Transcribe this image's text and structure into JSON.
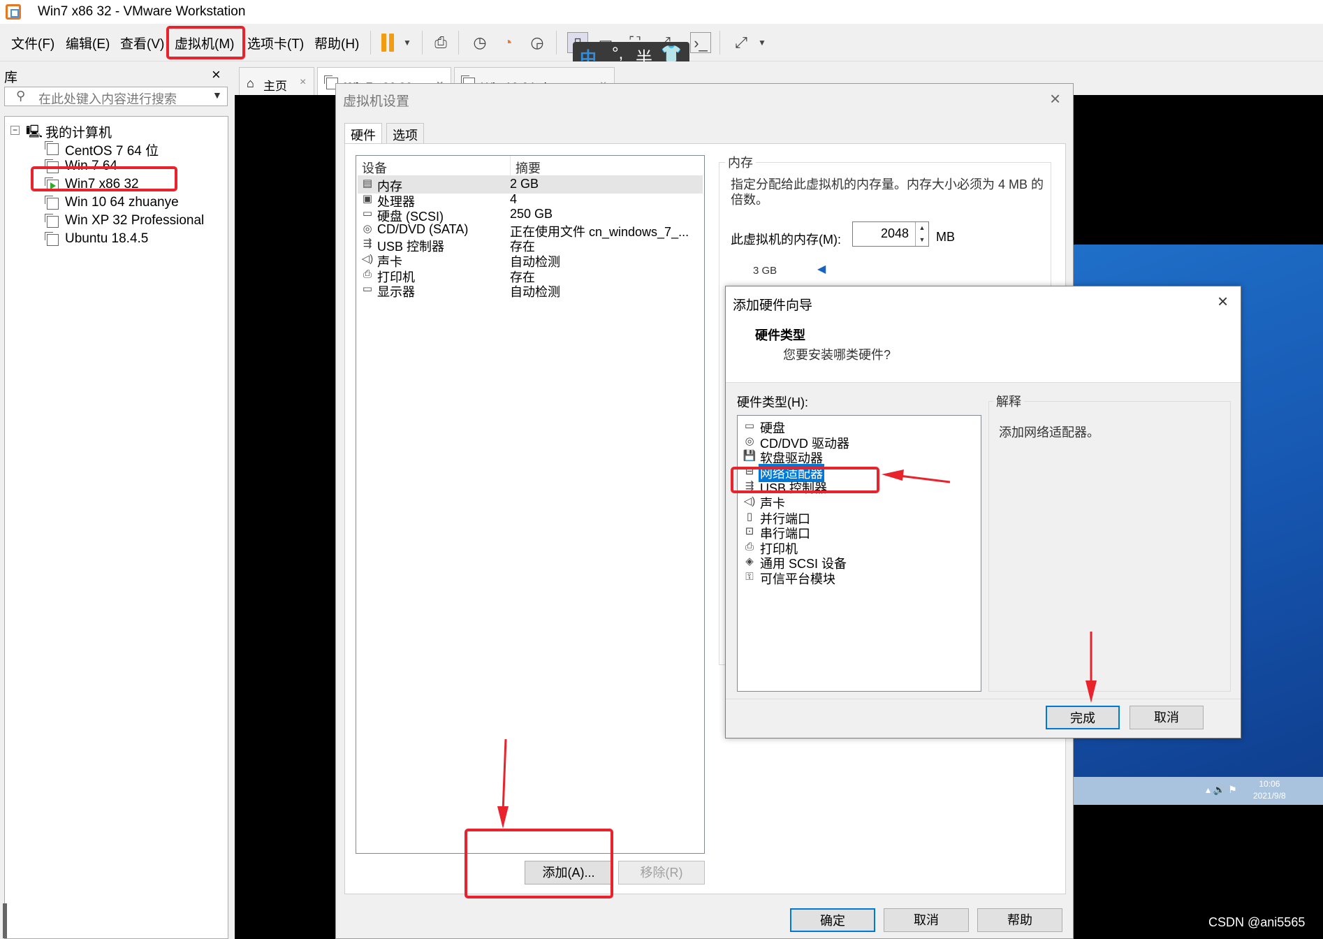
{
  "window": {
    "title": "Win7  x86  32 - VMware Workstation"
  },
  "menu": {
    "file": "文件(F)",
    "edit": "编辑(E)",
    "view": "查看(V)",
    "vm": "虚拟机(M)",
    "tabs": "选项卡(T)",
    "help": "帮助(H)"
  },
  "ime": {
    "mode": "中",
    "punct": "°,",
    "width": "半",
    "skin": "👕"
  },
  "library": {
    "title": "库",
    "search_placeholder": "在此处键入内容进行搜索",
    "root": "我的计算机",
    "vms": [
      "CentOS 7 64 位",
      "Win 7 64",
      "Win7  x86  32",
      "Win 10 64 zhuanye",
      "Win XP  32 Professional",
      "Ubuntu 18.4.5"
    ]
  },
  "doc_tabs": [
    {
      "label": "主页"
    },
    {
      "label": "Win7  x86  32"
    },
    {
      "label": "Win 10 64 zhuanye"
    }
  ],
  "settings": {
    "title": "虚拟机设置",
    "tabs": [
      "硬件",
      "选项"
    ],
    "col_device": "设备",
    "col_summary": "摘要",
    "devices": [
      {
        "icon": "memory-icon",
        "name": "内存",
        "summary": "2 GB"
      },
      {
        "icon": "processor-icon",
        "name": "处理器",
        "summary": "4"
      },
      {
        "icon": "harddisk-icon",
        "name": "硬盘 (SCSI)",
        "summary": "250 GB"
      },
      {
        "icon": "cd-icon",
        "name": "CD/DVD (SATA)",
        "summary": "正在使用文件 cn_windows_7_..."
      },
      {
        "icon": "usb-icon",
        "name": "USB 控制器",
        "summary": "存在"
      },
      {
        "icon": "sound-icon",
        "name": "声卡",
        "summary": "自动检测"
      },
      {
        "icon": "printer-icon",
        "name": "打印机",
        "summary": "存在"
      },
      {
        "icon": "display-icon",
        "name": "显示器",
        "summary": "自动检测"
      }
    ],
    "memory": {
      "group": "内存",
      "desc": "指定分配给此虚拟机的内存量。内存大小必须为 4 MB 的倍数。",
      "label": "此虚拟机的内存(M):",
      "value": "2048",
      "unit": "MB",
      "tick": "3 GB"
    },
    "add_button": "添加(A)...",
    "remove_button": "移除(R)",
    "ok": "确定",
    "cancel": "取消",
    "help": "帮助"
  },
  "wizard": {
    "title": "添加硬件向导",
    "heading": "硬件类型",
    "subheading": "您要安装哪类硬件?",
    "list_label": "硬件类型(H):",
    "types": [
      {
        "icon": "harddisk-icon",
        "name": "硬盘"
      },
      {
        "icon": "cd-icon",
        "name": "CD/DVD 驱动器"
      },
      {
        "icon": "floppy-icon",
        "name": "软盘驱动器"
      },
      {
        "icon": "network-icon",
        "name": "网络适配器",
        "selected": true
      },
      {
        "icon": "usb-icon",
        "name": "USB 控制器"
      },
      {
        "icon": "sound-icon",
        "name": "声卡"
      },
      {
        "icon": "parallel-port-icon",
        "name": "并行端口"
      },
      {
        "icon": "serial-port-icon",
        "name": "串行端口"
      },
      {
        "icon": "printer-icon",
        "name": "打印机"
      },
      {
        "icon": "scsi-icon",
        "name": "通用 SCSI 设备"
      },
      {
        "icon": "tpm-icon",
        "name": "可信平台模块"
      }
    ],
    "explain_label": "解释",
    "explain_text": "添加网络适配器。",
    "finish": "完成",
    "cancel": "取消"
  },
  "guest_clock": {
    "time": "10:06",
    "date": "2021/9/8"
  },
  "watermark": "CSDN @ani5565",
  "colors": {
    "highlight": "#e8232b",
    "selection": "#0078d7",
    "pause": "#f39c12"
  }
}
